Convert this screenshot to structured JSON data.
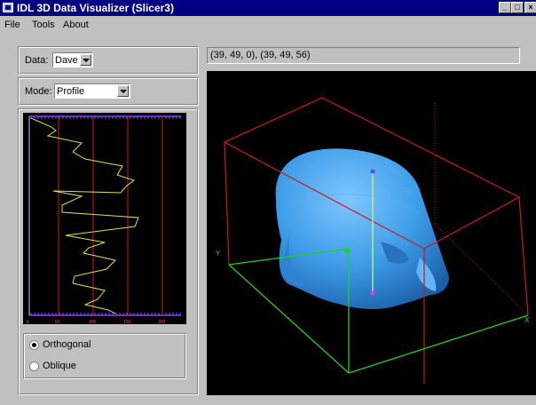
{
  "window": {
    "title": "IDL 3D Data Visualizer (Slicer3)"
  },
  "titlebar_buttons": {
    "minimize": "_",
    "maximize": "□",
    "close": "×"
  },
  "menu": [
    {
      "label": "File"
    },
    {
      "label": "Tools"
    },
    {
      "label": "About"
    }
  ],
  "data_selector": {
    "label": "Data:",
    "value": "Dave"
  },
  "mode_selector": {
    "label": "Mode:",
    "value": "Profile"
  },
  "profile_plot": {
    "x_ticks": [
      "0",
      "50",
      "100",
      "150",
      "200"
    ]
  },
  "orientation": {
    "options": [
      {
        "label": "Orthogonal",
        "selected": true
      },
      {
        "label": "Oblique",
        "selected": false
      }
    ]
  },
  "coordinates": {
    "text": "(39, 49, 0), (39, 49, 56)"
  },
  "colors": {
    "title_bar": "#000080",
    "face": "#c0c0c0",
    "volume": "#4aa8ee",
    "bbox_red": "#d01818",
    "axis_green": "#1fd11f",
    "profile_line": "#e8e040"
  }
}
